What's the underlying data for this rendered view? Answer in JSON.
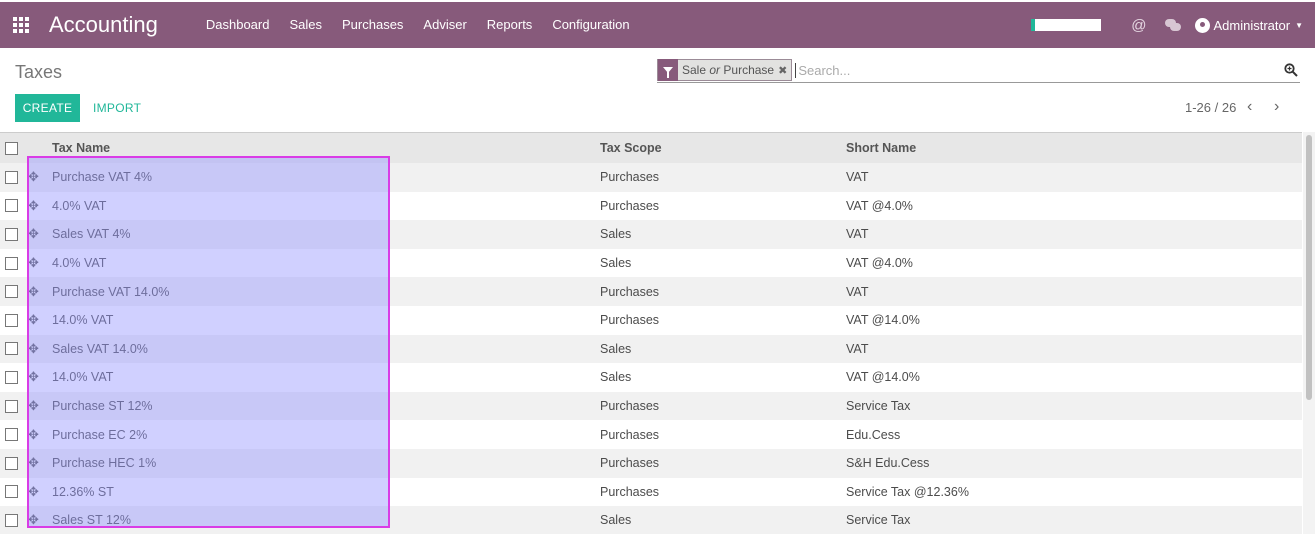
{
  "app": {
    "title": "Accounting"
  },
  "menu": [
    {
      "label": "Dashboard"
    },
    {
      "label": "Sales"
    },
    {
      "label": "Purchases"
    },
    {
      "label": "Adviser"
    },
    {
      "label": "Reports"
    },
    {
      "label": "Configuration"
    }
  ],
  "user": {
    "name": "Administrator"
  },
  "breadcrumb": "Taxes",
  "search": {
    "facet_part1": "Sale",
    "facet_or": "or",
    "facet_part2": "Purchase",
    "placeholder": "Search...",
    "remove_glyph": "✖"
  },
  "buttons": {
    "create": "CREATE",
    "import": "IMPORT"
  },
  "pager": {
    "range": "1-26 / 26",
    "prev": "‹",
    "next": "›"
  },
  "table": {
    "headers": {
      "name": "Tax Name",
      "scope": "Tax Scope",
      "short": "Short Name"
    },
    "rows": [
      {
        "name": "Purchase VAT 4%",
        "scope": "Purchases",
        "short": "VAT"
      },
      {
        "name": "4.0% VAT",
        "scope": "Purchases",
        "short": "VAT @4.0%"
      },
      {
        "name": "Sales VAT 4%",
        "scope": "Sales",
        "short": "VAT"
      },
      {
        "name": "4.0% VAT",
        "scope": "Sales",
        "short": "VAT @4.0%"
      },
      {
        "name": "Purchase VAT 14.0%",
        "scope": "Purchases",
        "short": "VAT"
      },
      {
        "name": "14.0% VAT",
        "scope": "Purchases",
        "short": "VAT @14.0%"
      },
      {
        "name": "Sales VAT 14.0%",
        "scope": "Sales",
        "short": "VAT"
      },
      {
        "name": "14.0% VAT",
        "scope": "Sales",
        "short": "VAT @14.0%"
      },
      {
        "name": "Purchase ST 12%",
        "scope": "Purchases",
        "short": "Service Tax"
      },
      {
        "name": "Purchase EC 2%",
        "scope": "Purchases",
        "short": "Edu.Cess"
      },
      {
        "name": "Purchase HEC 1%",
        "scope": "Purchases",
        "short": "S&H Edu.Cess"
      },
      {
        "name": "12.36% ST",
        "scope": "Purchases",
        "short": "Service Tax @12.36%"
      },
      {
        "name": "Sales ST 12%",
        "scope": "Sales",
        "short": "Service Tax"
      }
    ]
  },
  "icons": {
    "apps": "apps-grid-icon",
    "mention": "at-icon",
    "chat": "chat-icon",
    "drag": "drag-handle-icon",
    "search": "magnifier-icon",
    "filter": "funnel-icon"
  },
  "colors": {
    "brand": "#875a7b",
    "accent": "#21b799",
    "highlight": "#d93ce6"
  }
}
